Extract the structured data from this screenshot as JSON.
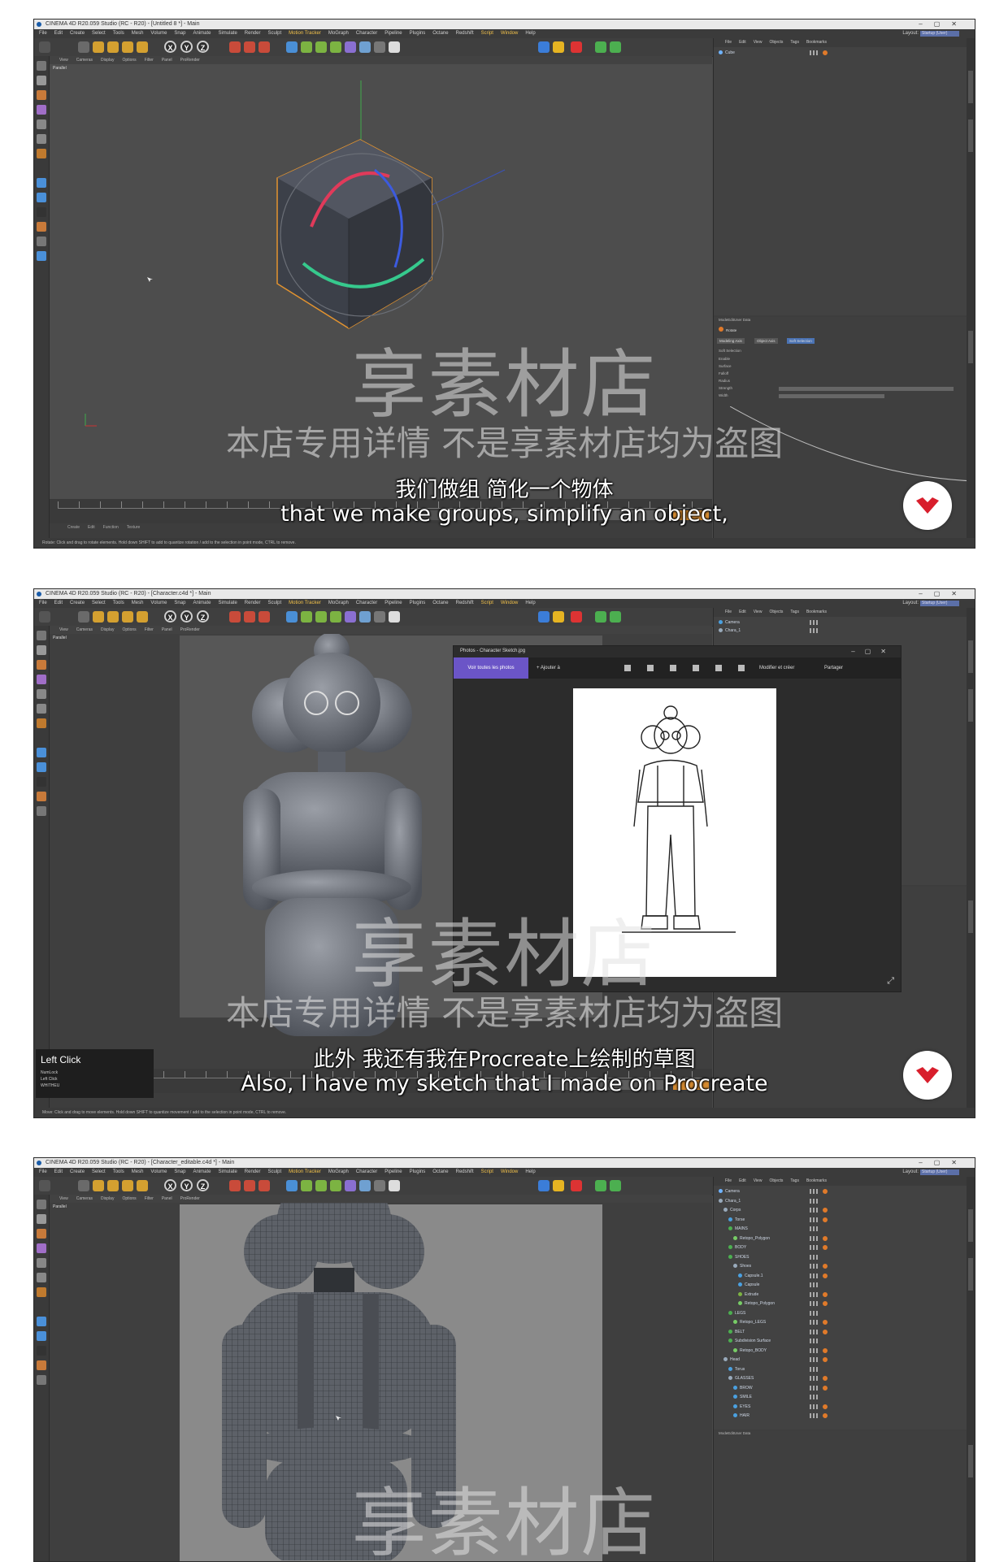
{
  "watermark": {
    "main": "享素材店",
    "sub": "本店专用详情 不是享素材店均为盗图"
  },
  "menu": [
    "File",
    "Edit",
    "Create",
    "Select",
    "Tools",
    "Mesh",
    "Volume",
    "Snap",
    "Animate",
    "Simulate",
    "Render",
    "Sculpt",
    "Motion Tracker",
    "MoGraph",
    "Character",
    "Pipeline",
    "Plugins",
    "Octane",
    "Redshift",
    "Script",
    "Window",
    "Help"
  ],
  "layout_label": "Layout:",
  "layout_value": "Startup (User)",
  "viewport_menu": [
    "View",
    "Cameras",
    "Display",
    "Options",
    "Filter",
    "Panel",
    "ProRender"
  ],
  "viewport_label": "Parallel",
  "material_menu": [
    "Create",
    "Edit",
    "Function",
    "Texture"
  ],
  "right_tabs": [
    "File",
    "Edit",
    "View",
    "Objects",
    "Tags",
    "Bookmarks"
  ],
  "attr_tabs": [
    "Mode",
    "Edit",
    "User Data"
  ],
  "shots": [
    {
      "title": "CINEMA 4D R20.059 Studio (RC - R20) - [Untitled 8 *] - Main",
      "sub_zh": "我们做组 简化一个物体",
      "sub_en": "that we make groups, simplify an object,",
      "objects": [
        "Cube"
      ],
      "attr_title": "Rotate",
      "attr_tabs": [
        "Modeling Axis",
        "Object Axis",
        "Soft Selection"
      ],
      "attr_section": "Soft Selection",
      "attr_rows": [
        "Enable",
        "Surface",
        "Falloff",
        "Radius",
        "Strength",
        "Width"
      ],
      "status": "Rotate: Click and drag to rotate elements. Hold down SHIFT to add to quantize rotation / add to the selection in point mode, CTRL to remove."
    },
    {
      "title": "CINEMA 4D R20.059 Studio (RC - R20) - [Character.c4d *] - Main",
      "sub_zh": "此外 我还有我在Procreate上绘制的草图",
      "sub_en": "Also, I have my sketch that I made on Procreate",
      "objects": [
        "Camera",
        "Chara_1"
      ],
      "photos": {
        "title": "Photos - Character Sketch.jpg",
        "view_all": "Voir toutes les photos",
        "add": "+ Ajouter à",
        "edit": "Modifier et créer",
        "share": "Partager"
      },
      "leftclick": {
        "title": "Left Click",
        "lines": [
          "NumLock",
          "Left Click",
          "WHITHEU"
        ]
      },
      "status": "Move: Click and drag to move elements. Hold down SHIFT to quantize movement / add to the selection in point mode, CTRL to remove."
    },
    {
      "title": "CINEMA 4D R20.059 Studio (RC - R20) - [Character_editable.c4d *] - Main",
      "objects": [
        "Camera",
        "Chara_1",
        "Corps",
        "Torse",
        "MAINS",
        "Retopo_Polygon",
        "BODY",
        "SHOES",
        "Shoes",
        "Capsule.1",
        "Capsule",
        "Extrude",
        "Retopo_Polygon",
        "LEGS",
        "Retopo_LEGS",
        "BELT",
        "Subdivision Surface",
        "Retopo_BODY",
        "Head",
        "Torus",
        "GLASSES",
        "BROW",
        "SMILE",
        "EYES",
        "HAIR"
      ]
    }
  ],
  "colors": {
    "app_bg": "#4b4b4b",
    "panel": "#3d3d3d",
    "accent_orange": "#e07a2a",
    "select_blue": "#4b73b4",
    "badge_red": "#d81e2c"
  }
}
